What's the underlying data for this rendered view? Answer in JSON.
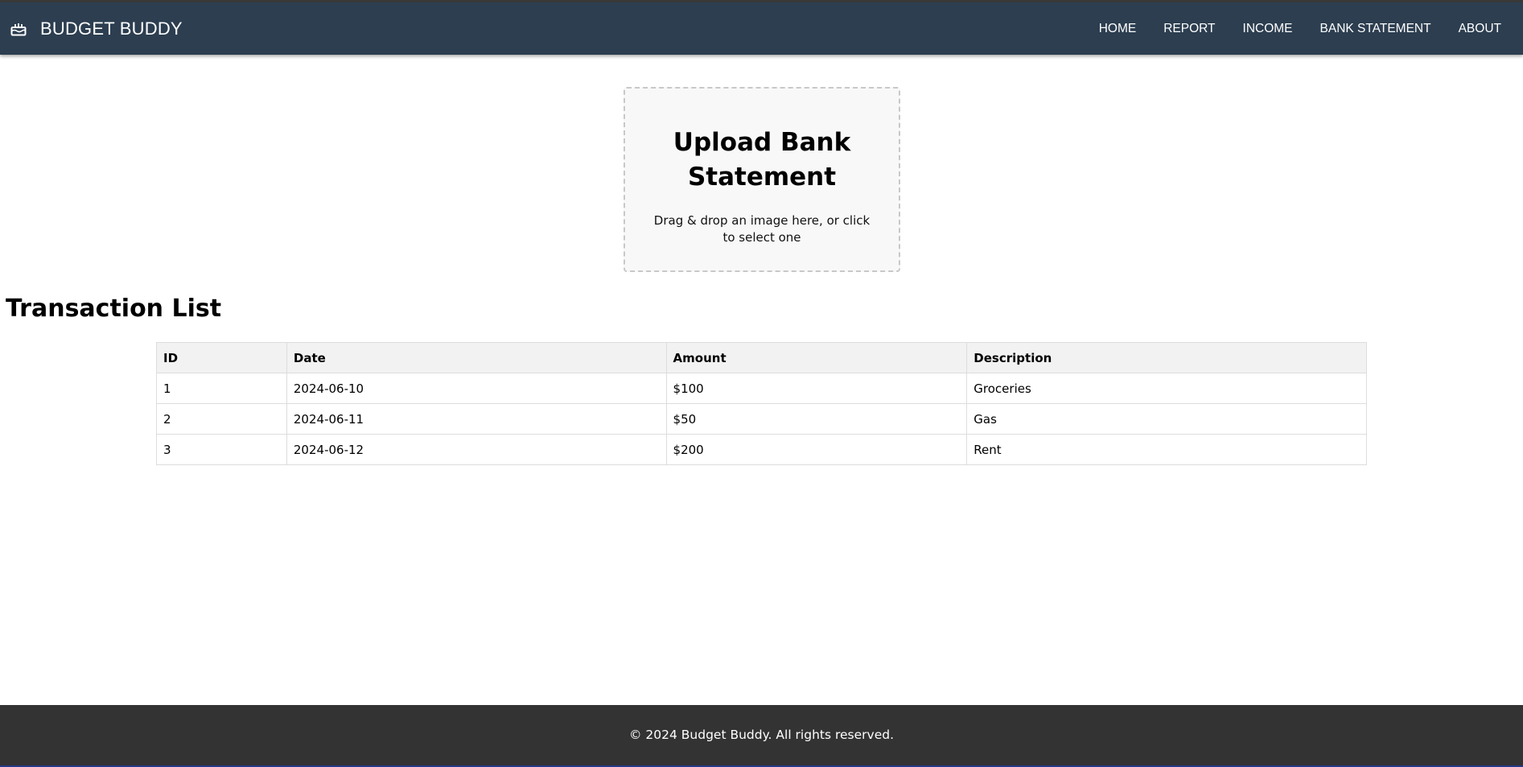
{
  "app": {
    "title": "BUDGET BUDDY",
    "icon": "cake-icon"
  },
  "nav": {
    "items": [
      {
        "label": "HOME"
      },
      {
        "label": "REPORT"
      },
      {
        "label": "INCOME"
      },
      {
        "label": "BANK STATEMENT"
      },
      {
        "label": "ABOUT"
      }
    ]
  },
  "upload": {
    "title": "Upload Bank Statement",
    "hint": "Drag & drop an image here, or click to select one"
  },
  "transactions": {
    "title": "Transaction List",
    "columns": [
      "ID",
      "Date",
      "Amount",
      "Description"
    ],
    "rows": [
      [
        "1",
        "2024-06-10",
        "$100",
        "Groceries"
      ],
      [
        "2",
        "2024-06-11",
        "$50",
        "Gas"
      ],
      [
        "3",
        "2024-06-12",
        "$200",
        "Rent"
      ]
    ]
  },
  "footer": {
    "text": "© 2024 Budget Buddy. All rights reserved."
  },
  "colors": {
    "navbar": "#2c3e50",
    "footer": "#333333",
    "table_header": "#f2f2f2"
  }
}
